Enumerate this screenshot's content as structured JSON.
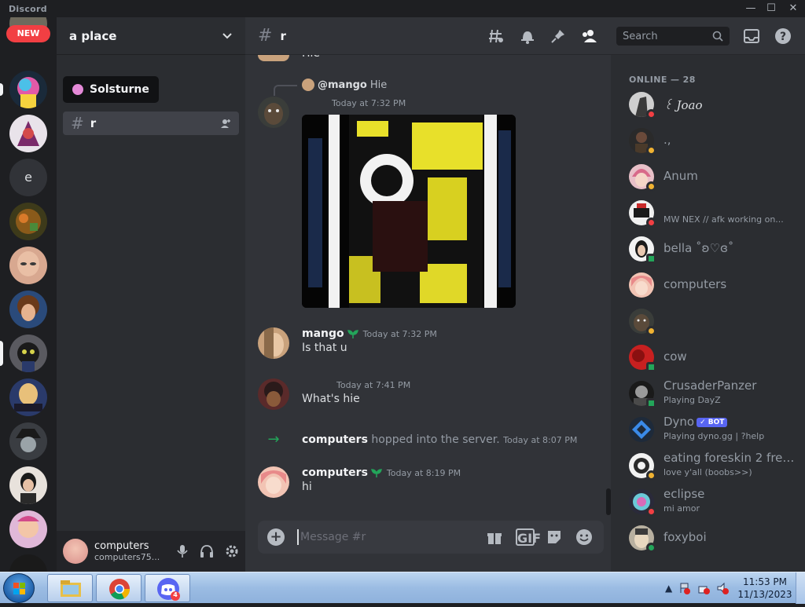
{
  "window": {
    "app_title": "Discord",
    "minimize": "—",
    "maximize": "☐",
    "close": "✕"
  },
  "guilds": {
    "new_badge": "NEW",
    "dm_label": "e",
    "tooltip": "Solsturne"
  },
  "server": {
    "name": "a place",
    "selected_channel": "r",
    "user": {
      "name": "computers",
      "status": "computers75..."
    }
  },
  "chat": {
    "channel": "r",
    "search_placeholder": "Search",
    "top_cut_text": "Hie",
    "reply": {
      "user": "@mango",
      "text": "Hie"
    },
    "messages": [
      {
        "author": "",
        "time": "Today at 7:32 PM",
        "text": ""
      },
      {
        "author": "mango",
        "time": "Today at 7:32 PM",
        "text": "Is that u"
      },
      {
        "author": "",
        "time": "Today at 7:41 PM",
        "text": "What's hie"
      },
      {
        "author": "computers",
        "time": "Today at 8:19 PM",
        "text": "hi"
      }
    ],
    "system": {
      "user": "computers",
      "text": "hopped into the server.",
      "time": "Today at 8:07 PM"
    },
    "composer_placeholder": "Message #r",
    "gif_label": "GIF"
  },
  "members": {
    "heading": "ONLINE — 28",
    "list": [
      {
        "name": "꒰ Joao",
        "sub": "",
        "status": "dnd"
      },
      {
        "name": ".,",
        "sub": "",
        "status": "idle"
      },
      {
        "name": "Anum",
        "sub": "",
        "status": "idle"
      },
      {
        "name": "",
        "sub": "MW NEX // afk working on...",
        "status": "dnd"
      },
      {
        "name": "bella ˚ʚ♡ɞ˚",
        "sub": "",
        "status": "mobile"
      },
      {
        "name": "computers",
        "sub": "",
        "status": "none"
      },
      {
        "name": "",
        "sub": "",
        "status": "idle"
      },
      {
        "name": "cow",
        "sub": "",
        "status": "mobile"
      },
      {
        "name": "CrusaderPanzer",
        "sub": "Playing DayZ",
        "status": "mobile"
      },
      {
        "name": "Dyno",
        "sub": "Playing dyno.gg | ?help",
        "status": "none",
        "badge": "✓ BOT"
      },
      {
        "name": "eating foreskin 2 free ...",
        "sub": "love y'all (boobs>>)",
        "status": "idle"
      },
      {
        "name": "eclipse",
        "sub": "mi amor",
        "status": "dnd"
      },
      {
        "name": "foxyboi",
        "sub": "",
        "status": "online"
      }
    ]
  },
  "taskbar": {
    "time": "11:53 PM",
    "date": "11/13/2023",
    "discord_badge": "4"
  },
  "colors": {
    "online": "#23a55a",
    "idle": "#f0b232",
    "dnd": "#f23f43",
    "accent": "#5865f2",
    "red_name": "#8b2c2c"
  }
}
